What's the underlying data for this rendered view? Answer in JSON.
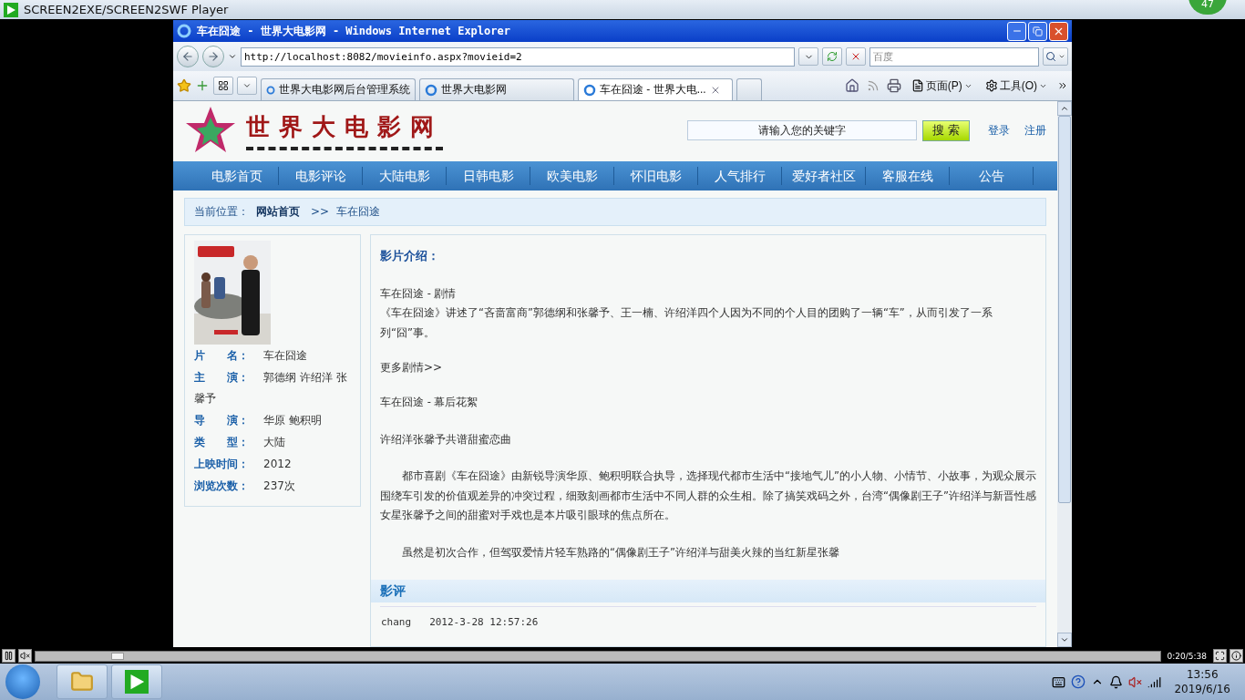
{
  "player": {
    "title": "SCREEN2EXE/SCREEN2SWF Player",
    "badge": "47",
    "time": "0:20/5:38",
    "level": 0.067
  },
  "browser": {
    "title": "车在囧途 - 世界大电影网 - Windows Internet Explorer",
    "address": "http://localhost:8082/movieinfo.aspx?movieid=2",
    "search_placeholder": "百度",
    "tabs": [
      {
        "label": "世界大电影网后台管理系统",
        "selected": false
      },
      {
        "label": "世界大电影网",
        "selected": false
      },
      {
        "label": "车在囧途 - 世界大电...",
        "selected": true
      }
    ],
    "commands": [
      "页面(P)",
      "工具(O)"
    ]
  },
  "site": {
    "logo_text": "世界大电影网",
    "search_placeholder": "请输入您的关键字",
    "search_button": "搜 索",
    "links": [
      "登录",
      "注册"
    ],
    "nav": [
      "电影首页",
      "电影评论",
      "大陆电影",
      "日韩电影",
      "欧美电影",
      "怀旧电影",
      "人气排行",
      "爱好者社区",
      "客服在线",
      "公告"
    ],
    "breadcrumb": {
      "label": "当前位置：",
      "home": "网站首页",
      "separator": ">>",
      "current": "车在囧途"
    },
    "info": [
      {
        "label": "片　　名：",
        "value": "车在囧途"
      },
      {
        "label": "主　　演：",
        "value": "郭德纲 许绍洋 张馨予"
      },
      {
        "label": "导　　演：",
        "value": "华原 鲍积明"
      },
      {
        "label": "类　　型：",
        "value": "大陆"
      },
      {
        "label": "上映时间：",
        "value": "2012"
      },
      {
        "label": "浏览次数：",
        "value": "237次"
      }
    ],
    "intro_title": "影片介绍：",
    "paragraphs": [
      {
        "kind": "plain",
        "text": "车在囧途 - 剧情"
      },
      {
        "kind": "tight",
        "text": "《车在囧途》讲述了“吝啬富商”郭德纲和张馨予、王一楠、许绍洋四个人因为不同的个人目的团购了一辆“车”，从而引发了一系列“囧”事。"
      },
      {
        "kind": "link",
        "text": "更多剧情>>"
      },
      {
        "kind": "plain",
        "text": "车在囧途 - 幕后花絮"
      },
      {
        "kind": "plain",
        "text": "许绍洋张馨予共谱甜蜜恋曲"
      },
      {
        "kind": "indent",
        "text": "都市喜剧《车在囧途》由新锐导演华原、鲍积明联合执导，选择现代都市生活中“接地气儿”的小人物、小情节、小故事，为观众展示围绕车引发的价值观差异的冲突过程，细致刻画都市生活中不同人群的众生相。除了搞笑戏码之外，台湾“偶像剧王子”许绍洋与新晋性感女星张馨予之间的甜蜜对手戏也是本片吸引眼球的焦点所在。"
      },
      {
        "kind": "indent",
        "text": "虽然是初次合作，但驾驭爱情片轻车熟路的“偶像剧王子”许绍洋与甜美火辣的当红新星张馨"
      }
    ],
    "review_title": "影评",
    "review": {
      "user": "chang",
      "time": "2012-3-28 12:57:26"
    }
  },
  "taskbar": {
    "time": "13:56",
    "date": "2019/6/16"
  }
}
